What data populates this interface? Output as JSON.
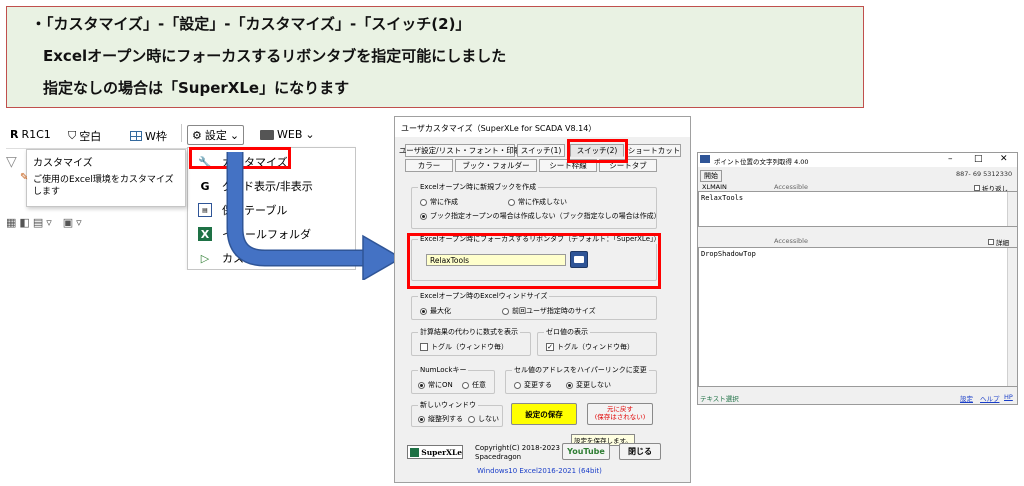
{
  "banner": {
    "line1": "・「カスタマイズ」-「設定」-「カスタマイズ」-「スイッチ(2)」",
    "line2": "Excelオープン時にフォーカスするリボンタブを指定可能にしました",
    "line3": "指定なしの場合は「SuperXLe」になります"
  },
  "ribbon": {
    "r1c1": "R1C1",
    "blank": "空白",
    "wframe": "W枠",
    "settings": "設定",
    "web": "WEB",
    "tooltip_title": "カスタマイズ",
    "tooltip_body": "ご使用のExcel環境をカスタマイズします",
    "menu": [
      {
        "label": "カスタマイズ",
        "icon": "customize-icon"
      },
      {
        "label": "グリッド表示/非表示",
        "icon": "grid-icon"
      },
      {
        "label": "保存用テーブル",
        "icon": "table-icon"
      },
      {
        "label": "インストールフォルダ",
        "icon": "excel-icon"
      },
      {
        "label": "カスタマイズ設定のエクスポート",
        "icon": "play-icon"
      }
    ],
    "menu_partial": [
      "グ",
      "ド表示/非表示",
      "保",
      "用テーブル",
      "イ",
      "ールフォルダ",
      "カス"
    ]
  },
  "dialog": {
    "title": "ユーザカスタマイズ（SuperXLe for SCADA V8.14）",
    "tabs_row1": [
      "ユーザ設定/リスト・フォント・印刷",
      "スイッチ(1)",
      "スイッチ(2)",
      "ショートカット"
    ],
    "tabs_row2": [
      "カラー",
      "ブック・フォルダー",
      "シート枠線",
      "シートタブ"
    ],
    "g1_label": "Excelオープン時に新規ブックを作成",
    "g1_opts": [
      "常に作成",
      "常に作成しない",
      "ブック指定オープンの場合は作成しない（ブック指定なしの場合は作成）"
    ],
    "g2_label": "Excelオープン時にフォーカスするリボンタブ（デフォルト：「SuperXLe」）",
    "g2_value": "RelaxTools",
    "g3_label": "Excelオープン時のExcelウィンドサイズ",
    "g3_opts": [
      "最大化",
      "前回ユーザ指定時のサイズ"
    ],
    "g4_label": "計算結果の代わりに数式を表示",
    "g4_opt": "トグル（ウィンドウ毎）",
    "g5_label": "ゼロ値の表示",
    "g5_opt": "トグル（ウィンドウ毎）",
    "g6_label": "NumLockキー",
    "g6_opts": [
      "常にON",
      "任意"
    ],
    "g7_label": "セル値のアドレスをハイパーリンクに変更",
    "g7_opts": [
      "変更する",
      "変更しない"
    ],
    "g8_label": "新しいウィンドウ",
    "g8_opts": [
      "縦整列する",
      "しない"
    ],
    "save_btn": "設定の保存",
    "reset_btn_1": "元に戻す",
    "reset_btn_2": "(保存はされない)",
    "logo_text": "SuperXLe",
    "copyright_1": "Copyright(C) 2018-2023",
    "copyright_2": "Spacedragon",
    "tooltip": "設定を保存します。",
    "youtube_btn": "YouTube",
    "close_btn": "閉じる",
    "env": "Windows10   Excel2016-2021 (64bit)"
  },
  "window": {
    "title": "ポイント位置の文字列取得 4.00",
    "start_btn": "開始",
    "coords": "887- 69 5312330",
    "xlmain": "XLMAIN",
    "accessible1": "Accessible",
    "wrap": "折り返し",
    "box1": "RelaxTools",
    "accessible2": "Accessible",
    "detail": "詳細",
    "box2": "DropShadowTop",
    "status": "テキスト選択",
    "link_settings": "設定",
    "link_help": "ヘルプ",
    "link_hp": "HP"
  },
  "colors": {
    "banner_bg": "#e9f2e3",
    "banner_border": "#c0504d",
    "highlight": "#ff0000",
    "arrow": "#4472c4",
    "save_btn": "#ffff00",
    "youtube_text": "#2e7d32",
    "env_text": "#1a3ec8"
  }
}
